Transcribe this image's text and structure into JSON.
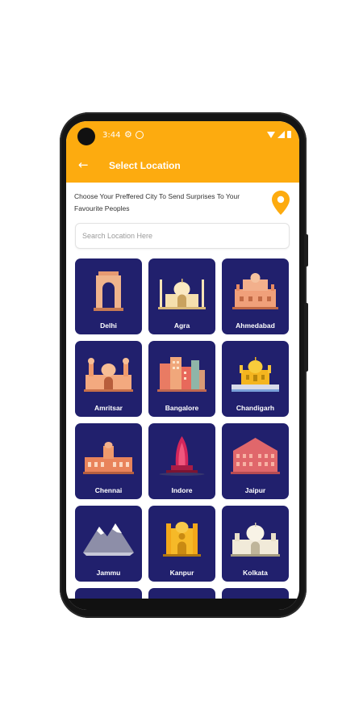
{
  "status_bar": {
    "time": "3:44"
  },
  "app_bar": {
    "title": "Select Location",
    "back_icon": "arrow-back-icon",
    "color": "#fdab0f"
  },
  "intro": {
    "text": "Choose Your Preffered City To Send Surprises To Your Favourite Peoples",
    "icon": "location-pin-icon"
  },
  "search": {
    "placeholder": "Search Location Here"
  },
  "cities": [
    {
      "name": "Delhi",
      "icon": "india-gate-icon"
    },
    {
      "name": "Agra",
      "icon": "taj-mahal-icon"
    },
    {
      "name": "Ahmedabad",
      "icon": "fort-icon"
    },
    {
      "name": "Amritsar",
      "icon": "palace-icon"
    },
    {
      "name": "Bangalore",
      "icon": "city-skyline-icon"
    },
    {
      "name": "Chandigarh",
      "icon": "golden-temple-icon"
    },
    {
      "name": "Chennai",
      "icon": "colonial-building-icon"
    },
    {
      "name": "Indore",
      "icon": "temple-icon"
    },
    {
      "name": "Jaipur",
      "icon": "hawa-mahal-icon"
    },
    {
      "name": "Jammu",
      "icon": "mountain-icon"
    },
    {
      "name": "Kanpur",
      "icon": "memorial-icon"
    },
    {
      "name": "Kolkata",
      "icon": "victoria-memorial-icon"
    }
  ],
  "colors": {
    "card_bg": "#21206d",
    "accent": "#fdab0f"
  }
}
